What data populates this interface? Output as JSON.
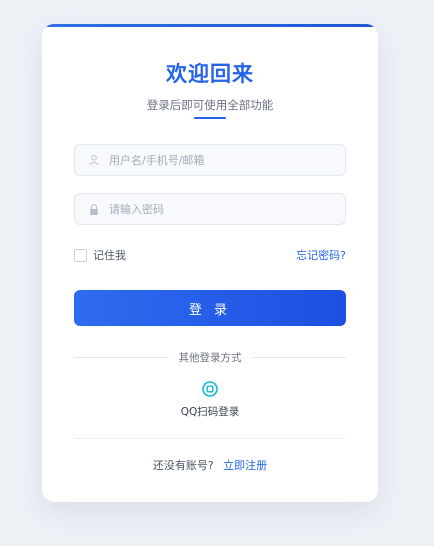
{
  "login": {
    "title": "欢迎回来",
    "subtitle": "登录后即可使用全部功能",
    "username_placeholder": "用户名/手机号/邮箱",
    "password_placeholder": "请输入密码",
    "remember_label": "记住我",
    "forgot_label": "忘记密码?",
    "submit_label": "登 录",
    "other_methods_label": "其他登录方式",
    "qq_label": "QQ扫码登录",
    "no_account_text": "还没有账号?",
    "register_label": "立即注册"
  },
  "colors": {
    "accent": "#2563eb",
    "background": "#eef2f7",
    "qq_icon": "#12b7d5"
  },
  "icons": {
    "username": "user-icon",
    "password": "lock-icon",
    "qq": "qq-icon"
  }
}
